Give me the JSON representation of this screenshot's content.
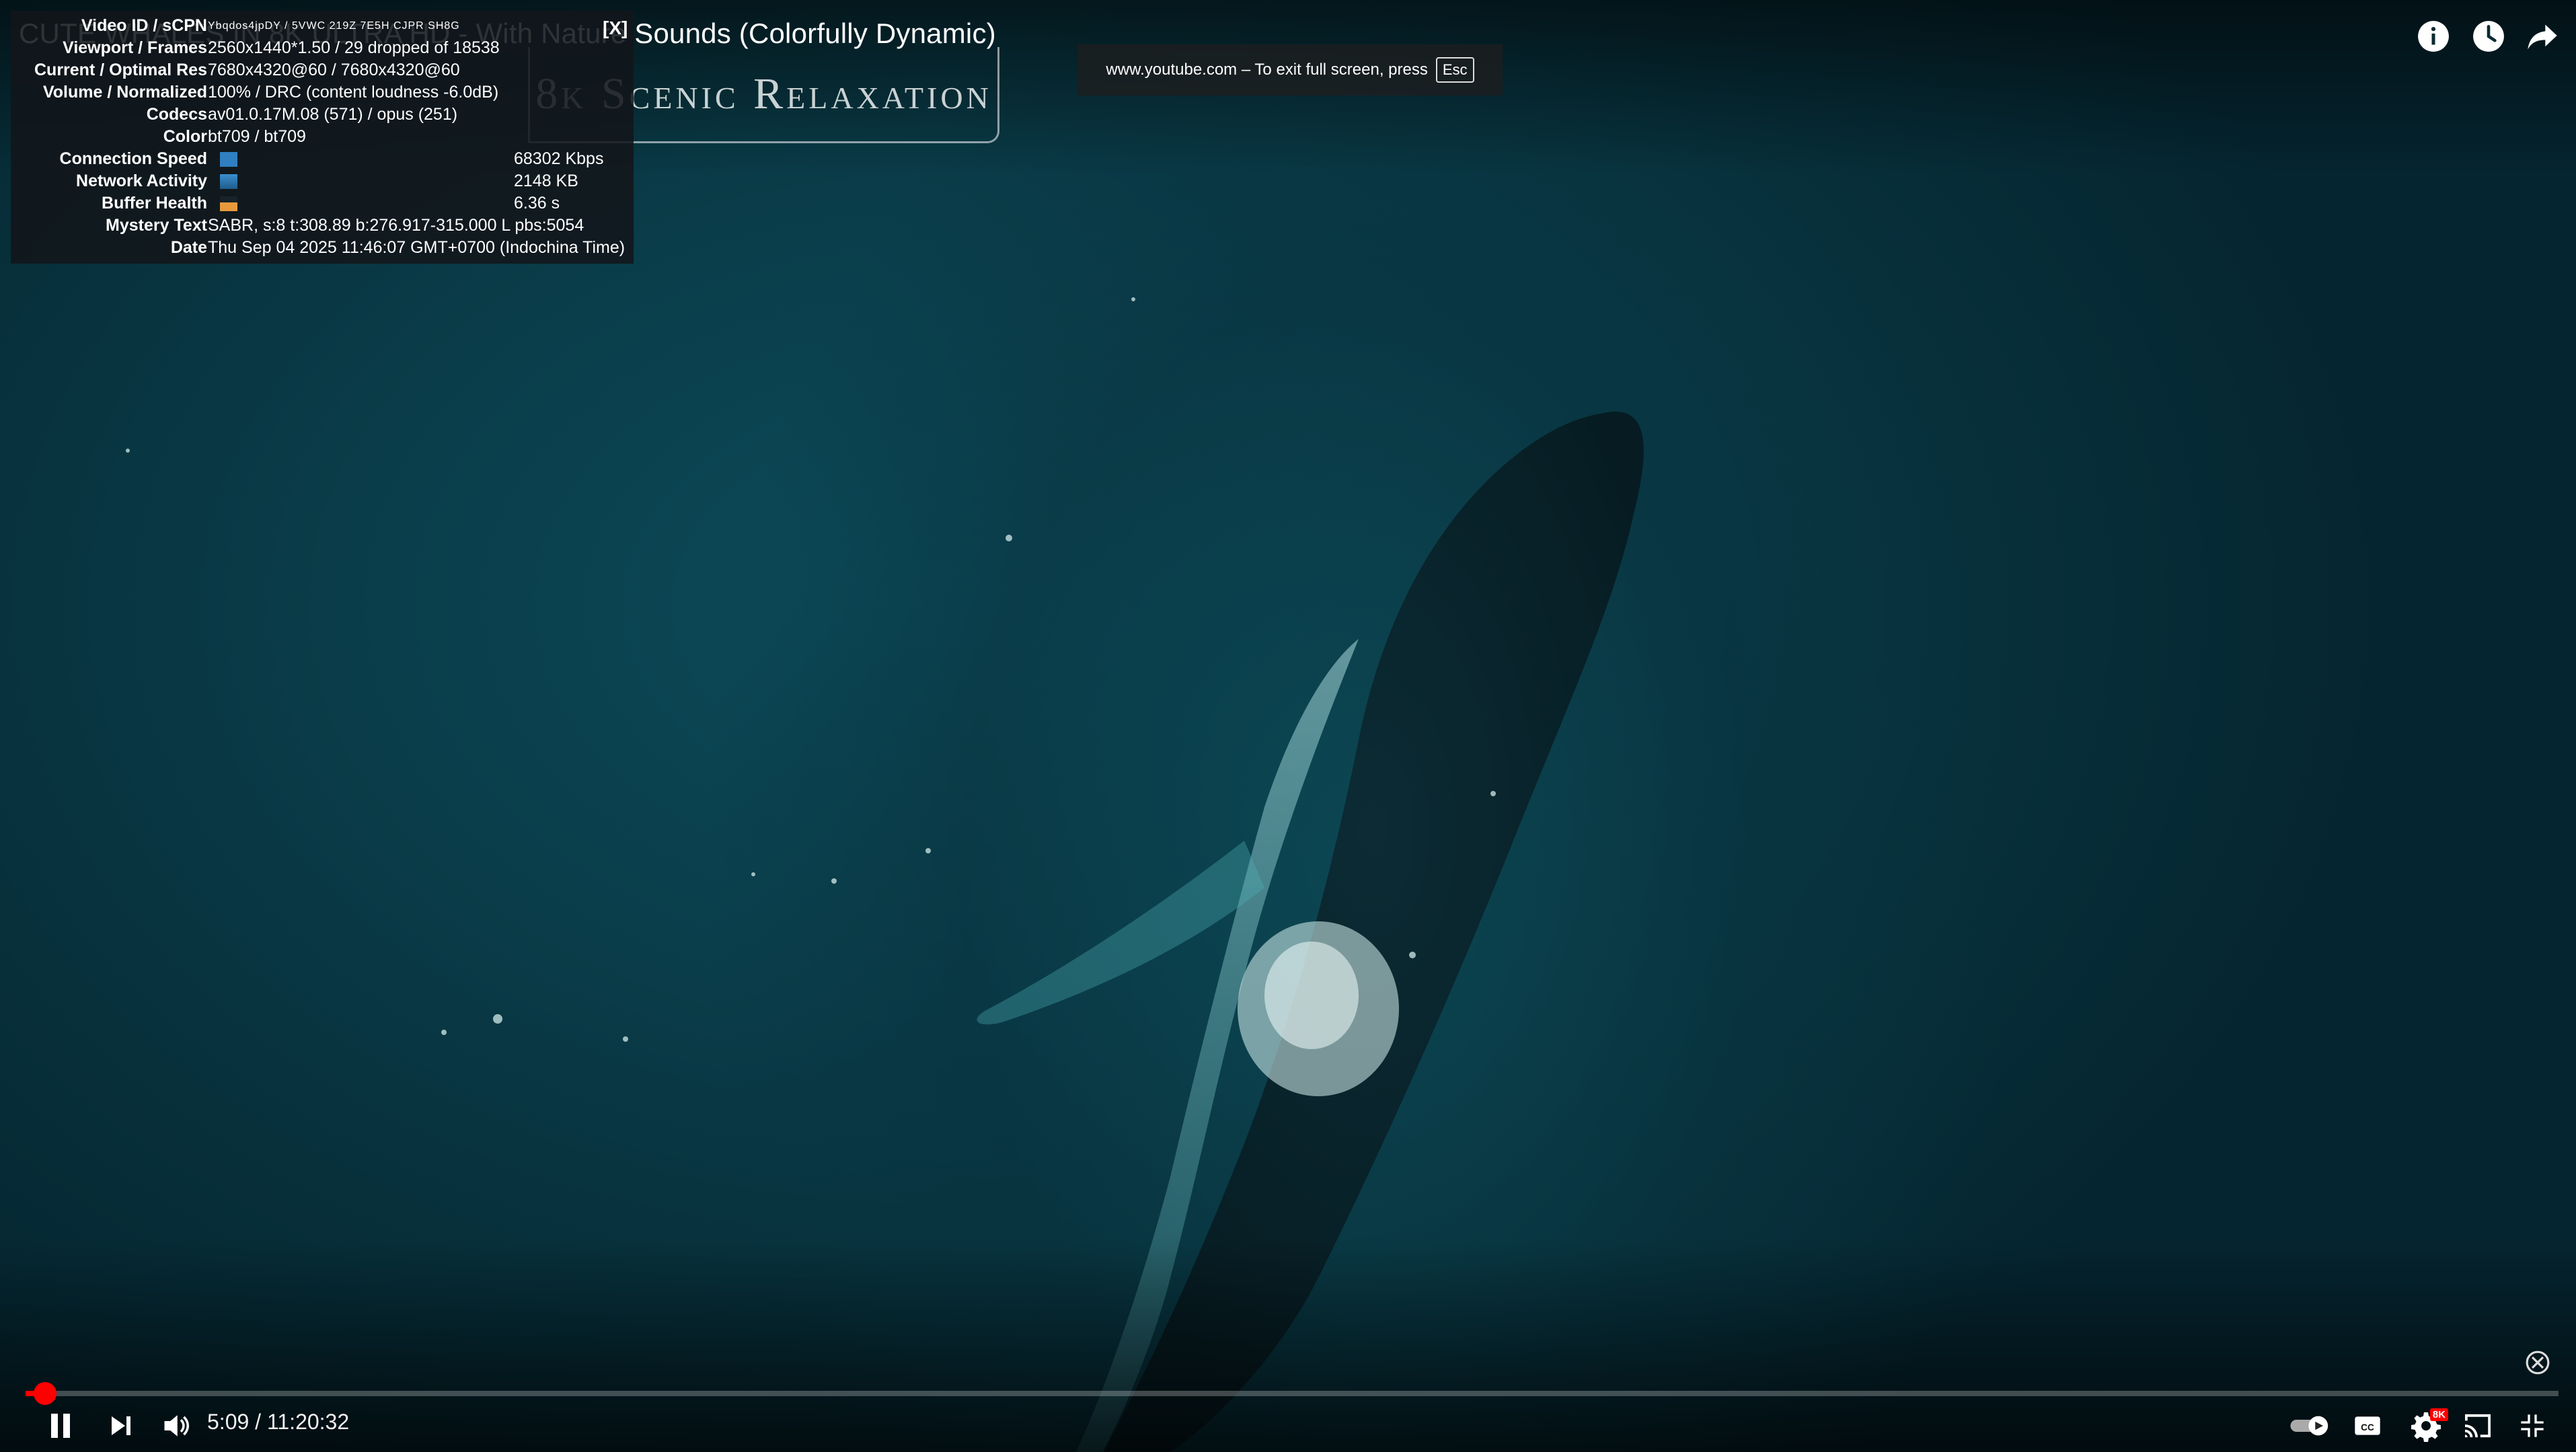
{
  "player": {
    "title": "CUTE WHALES IN 8K ULTRA HD - With Nature Sounds (Colorfully Dynamic)",
    "watermark": "8k Scenic Relaxation",
    "fullscreen_notice": {
      "text": "www.youtube.com – To exit full screen, press",
      "key": "Esc"
    },
    "time": {
      "current": "5:09",
      "separator": " / ",
      "duration": "11:20:32"
    },
    "progress_fraction": 0.0076,
    "accent_color": "#ff0000"
  },
  "stats": {
    "close_label": "[X]",
    "rows": [
      {
        "label": "Video ID / sCPN",
        "value": "Ybqdos4jpDY  /  5VWC 219Z 7E5H CJPR SH8G"
      },
      {
        "label": "Viewport / Frames",
        "value": "2560x1440*1.50 / 29 dropped of 18538"
      },
      {
        "label": "Current / Optimal Res",
        "value": "7680x4320@60 / 7680x4320@60"
      },
      {
        "label": "Volume / Normalized",
        "value": "100% / DRC (content loudness -6.0dB)"
      },
      {
        "label": "Codecs",
        "value": "av01.0.17M.08 (571) / opus (251)"
      },
      {
        "label": "Color",
        "value": "bt709 / bt709"
      },
      {
        "label": "Connection Speed",
        "value": "68302 Kbps"
      },
      {
        "label": "Network Activity",
        "value": "2148 KB"
      },
      {
        "label": "Buffer Health",
        "value": "6.36 s"
      },
      {
        "label": "Mystery Text",
        "value": "SABR, s:8 t:308.89 b:276.917-315.000 L pbs:5054"
      },
      {
        "label": "Date",
        "value": "Thu Sep 04 2025 11:46:07 GMT+0700 (Indochina Time)"
      }
    ]
  },
  "icons": {
    "top": [
      "info-icon",
      "watch-later-icon",
      "share-icon"
    ],
    "bottom_left": [
      "pause-icon",
      "next-icon",
      "volume-icon"
    ],
    "bottom_right": [
      "autoplay-toggle-icon",
      "captions-icon",
      "settings-icon",
      "cast-icon",
      "exit-fullscreen-icon"
    ],
    "quality_badge": "8K"
  }
}
